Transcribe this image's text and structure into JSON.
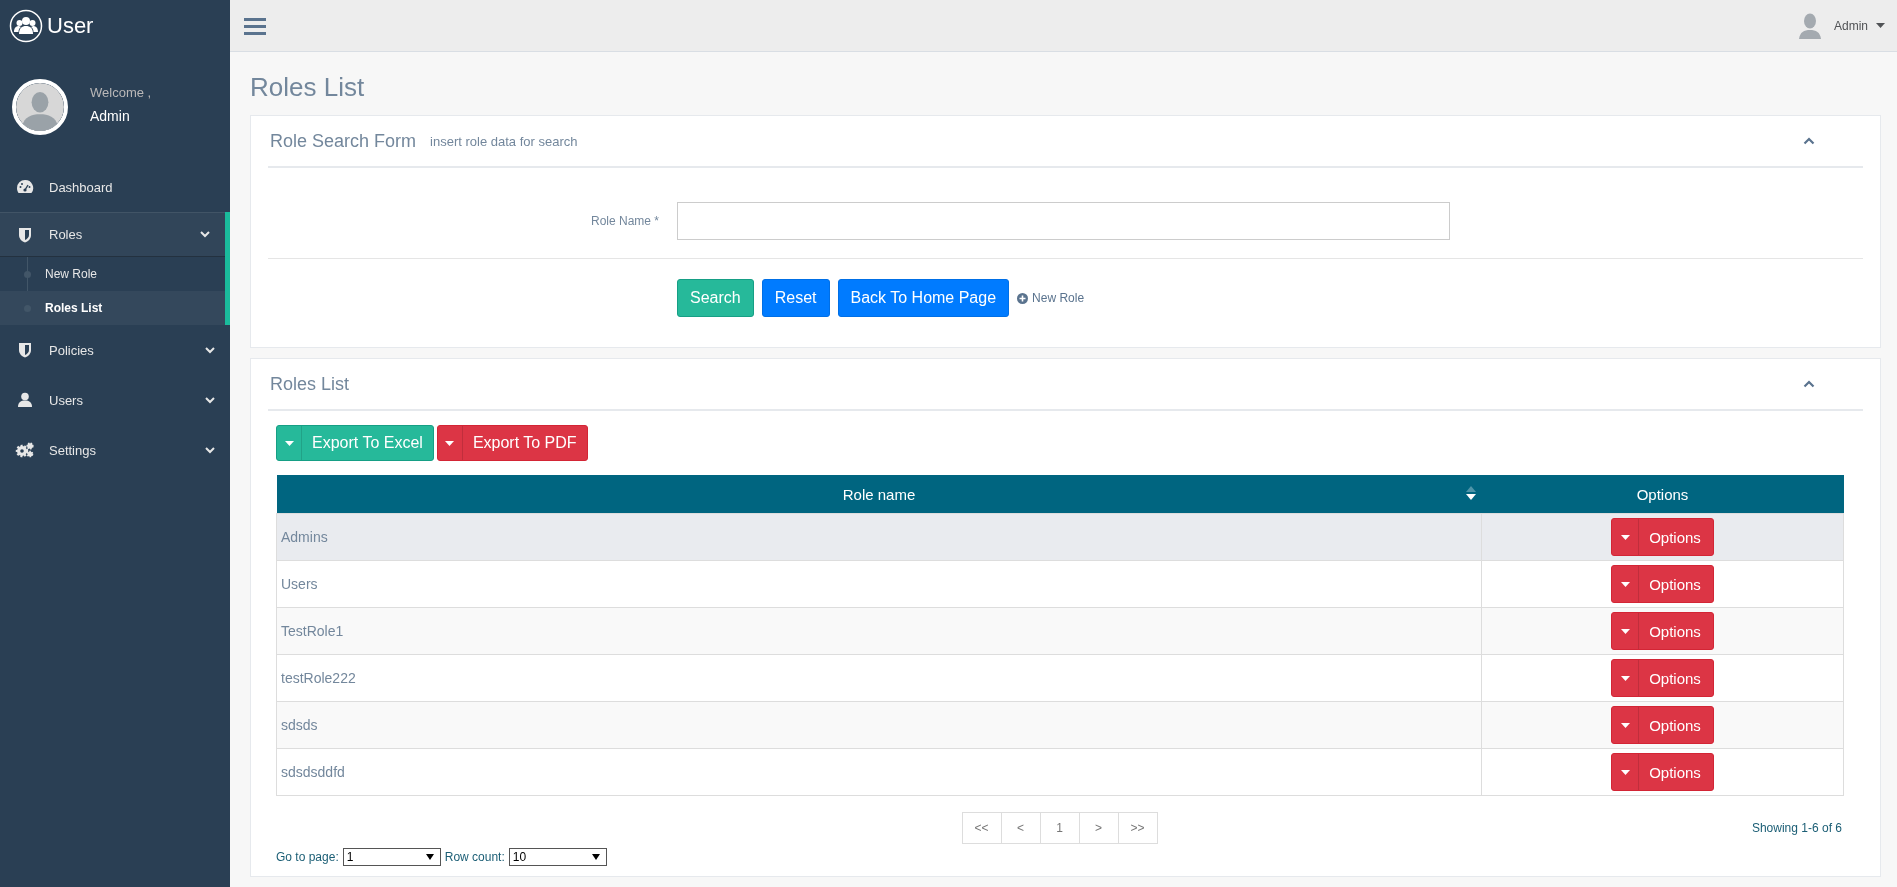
{
  "brand": {
    "title": "User"
  },
  "profile": {
    "greeting": "Welcome ,",
    "name": "Admin"
  },
  "sidebar": {
    "items": [
      {
        "label": "Dashboard",
        "kind": "link",
        "selected": false
      },
      {
        "label": "Roles",
        "kind": "group",
        "selected": true,
        "children": [
          {
            "label": "New Role",
            "selected": false
          },
          {
            "label": "Roles List",
            "selected": true
          }
        ]
      },
      {
        "label": "Policies",
        "kind": "group",
        "selected": false
      },
      {
        "label": "Users",
        "kind": "group",
        "selected": false
      },
      {
        "label": "Settings",
        "kind": "group",
        "selected": false
      }
    ]
  },
  "topbar": {
    "user": "Admin"
  },
  "page": {
    "title": "Roles List"
  },
  "search_form": {
    "title": "Role Search Form",
    "subtitle": "insert role data for search",
    "fields": [
      {
        "label": "Role Name *"
      }
    ],
    "buttons": [
      {
        "label": "Search",
        "kind": "success"
      },
      {
        "label": "Reset",
        "kind": "primary"
      },
      {
        "label": "Back To Home Page",
        "kind": "primary"
      }
    ],
    "link": "New Role"
  },
  "roles_list": {
    "title": "Roles List",
    "export_buttons": [
      {
        "label": "Export To Excel",
        "kind": "success"
      },
      {
        "label": "Export To PDF",
        "kind": "danger"
      }
    ],
    "table": {
      "columns": [
        "Role name",
        "Options"
      ],
      "rows": [
        {
          "role_name": "Admins",
          "action": "Options",
          "selected": true
        },
        {
          "role_name": "Users",
          "action": "Options",
          "selected": false
        },
        {
          "role_name": "TestRole1",
          "action": "Options",
          "selected": false
        },
        {
          "role_name": "testRole222",
          "action": "Options",
          "selected": false
        },
        {
          "role_name": "sdsds",
          "action": "Options",
          "selected": false
        },
        {
          "role_name": "sdsdsddfd",
          "action": "Options",
          "selected": false
        }
      ]
    },
    "pagination": [
      "<<",
      "<",
      "1",
      ">",
      ">>"
    ],
    "summary": "Showing 1-6 of 6",
    "go_to_page": {
      "label": "Go to page:",
      "value": "1"
    },
    "row_count": {
      "label": "Row count:",
      "value": "10"
    }
  }
}
